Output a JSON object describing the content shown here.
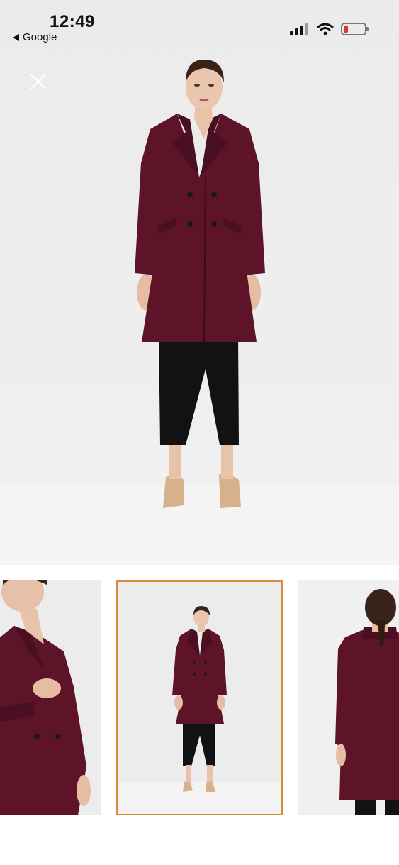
{
  "status_bar": {
    "time": "12:49",
    "back_app": "Google",
    "battery_color": "#e23030"
  },
  "viewer": {
    "close_icon": "close-icon",
    "coat_color": "#5d1428",
    "selected_border_color": "#d48c3a",
    "selected_index": 1,
    "thumbnails": [
      {
        "view": "close-up"
      },
      {
        "view": "full-front"
      },
      {
        "view": "back"
      }
    ]
  }
}
